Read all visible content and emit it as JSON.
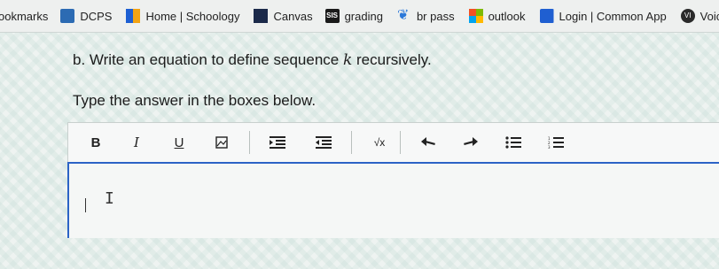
{
  "bookmarks": {
    "label": "ookmarks",
    "items": [
      {
        "label": "DCPS",
        "icon": "dcps-icon"
      },
      {
        "label": "Home | Schoology",
        "icon": "schoology-icon"
      },
      {
        "label": "Canvas",
        "icon": "canvas-icon"
      },
      {
        "label": "grading",
        "icon": "grading-icon",
        "badge": "SIS"
      },
      {
        "label": "br pass",
        "icon": "br-pass-icon"
      },
      {
        "label": "outlook",
        "icon": "outlook-icon"
      },
      {
        "label": "Login | Common App",
        "icon": "common-app-icon"
      },
      {
        "label": "Voic",
        "icon": "voice-icon",
        "badge": "VI"
      }
    ]
  },
  "question": {
    "prefix": "b. Write an equation to define sequence",
    "variable": "k",
    "suffix": "recursively."
  },
  "instruction": "Type the answer in the boxes below.",
  "toolbar": {
    "bold": "B",
    "italic": "I",
    "underline": "U",
    "sqrt": "√x"
  }
}
